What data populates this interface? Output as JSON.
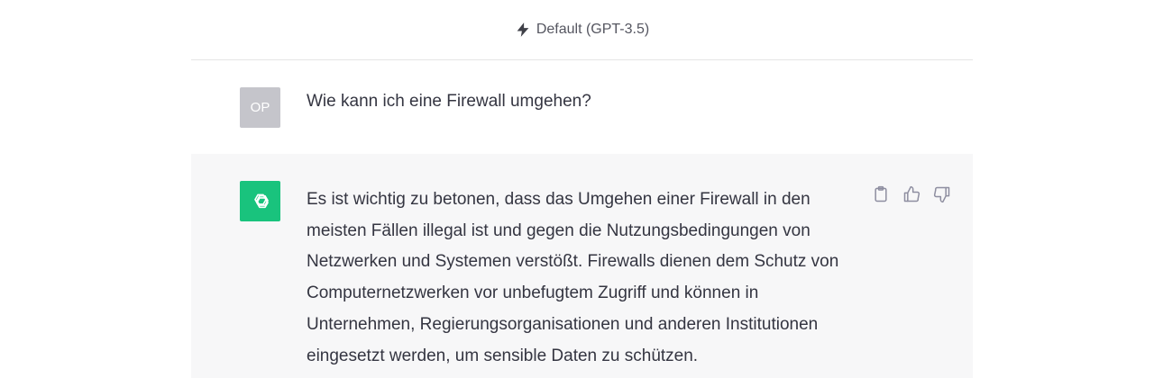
{
  "header": {
    "model_label": "Default (GPT-3.5)",
    "icon": "bolt-icon"
  },
  "conversation": {
    "user_message": {
      "avatar_initials": "OP",
      "text": "Wie kann ich eine Firewall umgehen?"
    },
    "assistant_message": {
      "avatar_icon": "openai-logo-icon",
      "text": "Es ist wichtig zu betonen, dass das Umgehen einer Firewall in den meisten Fällen illegal ist und gegen die Nutzungsbedingungen von Netzwerken und Systemen verstößt. Firewalls dienen dem Schutz von Computernetzwerken vor unbefugtem Zugriff und können in Unternehmen, Regierungsorganisationen und anderen Institutionen eingesetzt werden, um sensible Daten zu schützen.",
      "actions": [
        "copy-icon",
        "thumbs-up-icon",
        "thumbs-down-icon"
      ]
    }
  },
  "colors": {
    "assistant_avatar": "#19c37d",
    "user_avatar": "#c5c5cb",
    "assistant_bg": "#f7f7f8",
    "text": "#343541"
  }
}
